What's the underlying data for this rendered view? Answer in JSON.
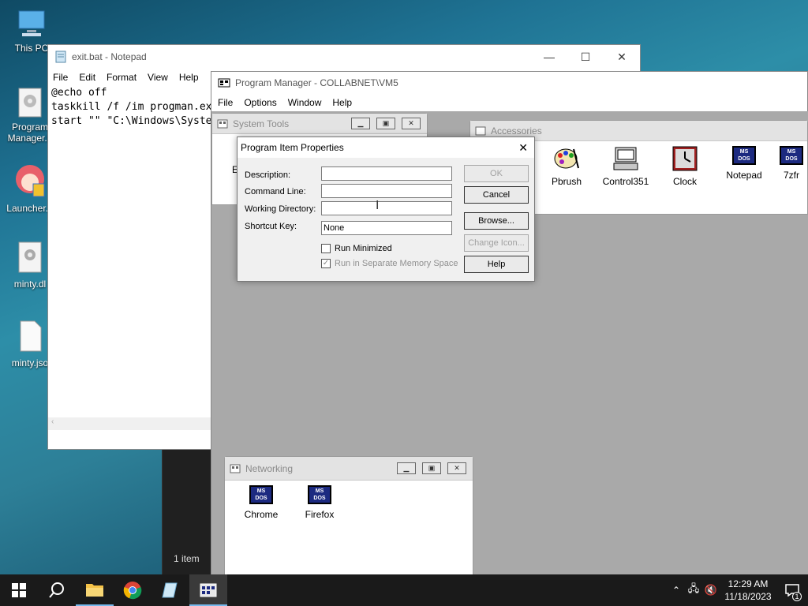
{
  "desktop": {
    "icons": [
      {
        "label": "This PC"
      },
      {
        "label": "Program Manager.b"
      },
      {
        "label": "Launcher.e"
      },
      {
        "label": "minty.dl"
      },
      {
        "label": "minty.jso"
      }
    ]
  },
  "notepad": {
    "title": "exit.bat - Notepad",
    "menu": [
      "File",
      "Edit",
      "Format",
      "View",
      "Help"
    ],
    "lines": [
      "@echo off",
      "taskkill /f /im progman.ex",
      "start \"\" \"C:\\Windows\\Syste"
    ]
  },
  "explorer_status": {
    "items": "1 item"
  },
  "progman": {
    "title": "Program Manager - COLLABNET\\VM5",
    "menu": [
      "File",
      "Options",
      "Window",
      "Help"
    ]
  },
  "system_tools": {
    "title": "System Tools",
    "partial_label": "E"
  },
  "accessories": {
    "title": "Accessories",
    "programs": [
      "Pbrush",
      "Control351",
      "Clock",
      "Notepad",
      "7zfr"
    ]
  },
  "networking": {
    "title": "Networking",
    "programs": [
      "Chrome",
      "Firefox"
    ]
  },
  "dialog": {
    "title": "Program Item Properties",
    "description_label": "Description:",
    "command_line_label": "Command Line:",
    "working_dir_label": "Working Directory:",
    "shortcut_key_label": "Shortcut Key:",
    "description_value": "",
    "command_line_value": "",
    "working_dir_value": "",
    "shortcut_key_value": "None",
    "run_minimized_label": "Run Minimized",
    "separate_memory_label": "Run in Separate Memory Space",
    "run_minimized_checked": false,
    "separate_memory_checked": true,
    "buttons": {
      "ok": "OK",
      "cancel": "Cancel",
      "browse": "Browse...",
      "change_icon": "Change Icon...",
      "help": "Help"
    }
  },
  "dos_icon_text": {
    "line1": "MS",
    "line2": "DOS"
  },
  "taskbar": {
    "time": "12:29 AM",
    "date": "11/18/2023",
    "notification_count": "1"
  },
  "colors": {
    "taskbar": "#1a1a1a",
    "dos_icon": "#1c2a80",
    "mdi_bg": "#a9a9a9"
  }
}
